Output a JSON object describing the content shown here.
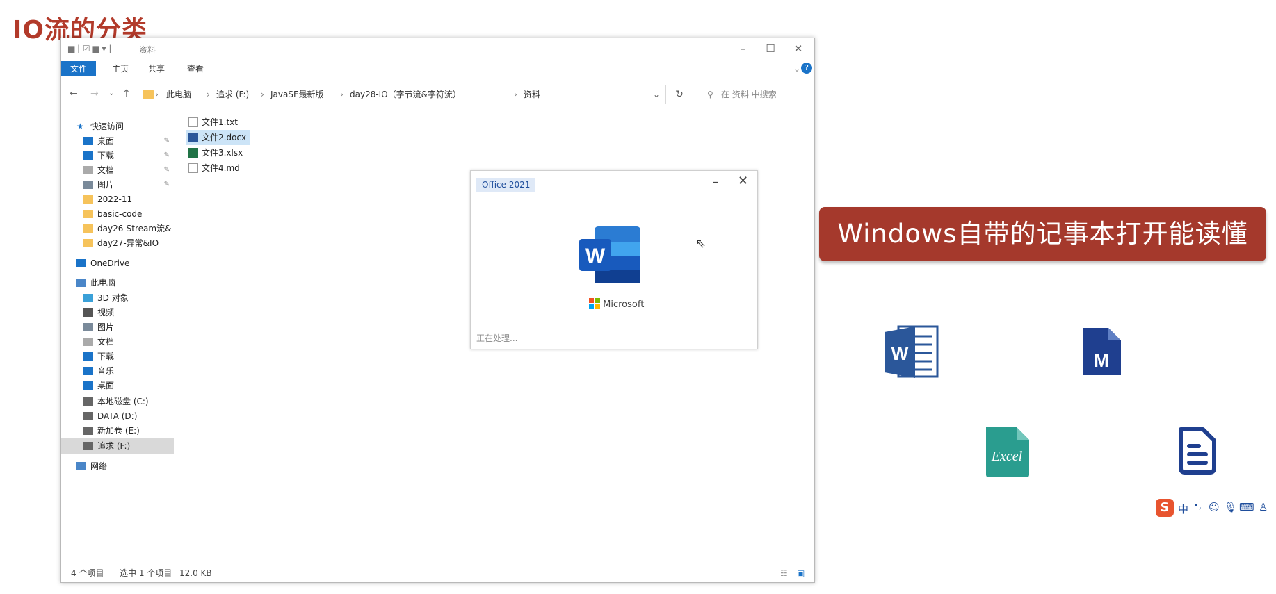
{
  "slide": {
    "title": "IO流的分类",
    "banner_text": "Windows自带的记事本打开能读懂",
    "banner_color": "#a5392c",
    "file_type_icons": [
      {
        "name": "word-doc-icon",
        "label": "W"
      },
      {
        "name": "markdown-file-icon",
        "label": "M"
      },
      {
        "name": "excel-file-icon",
        "label": "Excel"
      },
      {
        "name": "text-document-icon",
        "label": ""
      }
    ],
    "ime_toolbar": {
      "mode": "中",
      "punct": "•,",
      "icons": [
        "ime-logo-icon",
        "emoji-icon",
        "mic-icon",
        "keyboard-icon",
        "user-icon"
      ]
    }
  },
  "explorer": {
    "window_title": "资料",
    "ribbon_tabs": [
      "文件",
      "主页",
      "共享",
      "查看"
    ],
    "address": {
      "crumbs": [
        "此电脑",
        "追求 (F:)",
        "JavaSE最新版",
        "day28-IO（字节流&字符流）",
        "资料"
      ],
      "search_placeholder": "在 资料 中搜索"
    },
    "nav": [
      {
        "label": "快速访问",
        "icon": "star-icon",
        "indent": 1
      },
      {
        "label": "桌面",
        "icon": "desktop-icon",
        "indent": 2,
        "pin": true
      },
      {
        "label": "下载",
        "icon": "download-icon",
        "indent": 2,
        "pin": true
      },
      {
        "label": "文档",
        "icon": "document-icon",
        "indent": 2,
        "pin": true
      },
      {
        "label": "图片",
        "icon": "picture-icon",
        "indent": 2,
        "pin": true
      },
      {
        "label": "2022-11",
        "icon": "folder-icon",
        "indent": 2
      },
      {
        "label": "basic-code",
        "icon": "folder-icon",
        "indent": 2
      },
      {
        "label": "day26-Stream流&",
        "icon": "folder-icon",
        "indent": 2
      },
      {
        "label": "day27-异常&IO",
        "icon": "folder-icon",
        "indent": 2
      },
      {
        "label": "OneDrive",
        "icon": "cloud-icon",
        "indent": 1
      },
      {
        "label": "此电脑",
        "icon": "computer-icon",
        "indent": 1
      },
      {
        "label": "3D 对象",
        "icon": "cube-icon",
        "indent": 2
      },
      {
        "label": "视频",
        "icon": "video-icon",
        "indent": 2
      },
      {
        "label": "图片",
        "icon": "picture-icon",
        "indent": 2
      },
      {
        "label": "文档",
        "icon": "document-icon",
        "indent": 2
      },
      {
        "label": "下载",
        "icon": "download-icon",
        "indent": 2
      },
      {
        "label": "音乐",
        "icon": "music-icon",
        "indent": 2
      },
      {
        "label": "桌面",
        "icon": "desktop-icon",
        "indent": 2
      },
      {
        "label": "本地磁盘 (C:)",
        "icon": "drive-icon",
        "indent": 2
      },
      {
        "label": "DATA (D:)",
        "icon": "drive-icon",
        "indent": 2
      },
      {
        "label": "新加卷 (E:)",
        "icon": "drive-icon",
        "indent": 2
      },
      {
        "label": "追求 (F:)",
        "icon": "drive-icon",
        "indent": 2,
        "selected": true
      },
      {
        "label": "网络",
        "icon": "network-icon",
        "indent": 1
      }
    ],
    "files": [
      {
        "name": "文件1.txt",
        "icon": "txt-file-icon"
      },
      {
        "name": "文件2.docx",
        "icon": "word-file-icon",
        "selected": true
      },
      {
        "name": "文件3.xlsx",
        "icon": "excel-file-icon"
      },
      {
        "name": "文件4.md",
        "icon": "md-file-icon"
      }
    ],
    "status": {
      "count": "4 个项目",
      "selected": "选中 1 个项目",
      "size": "12.0 KB"
    }
  },
  "splash": {
    "badge": "Office 2021",
    "brand": "Microsoft",
    "status": "正在处理..."
  }
}
